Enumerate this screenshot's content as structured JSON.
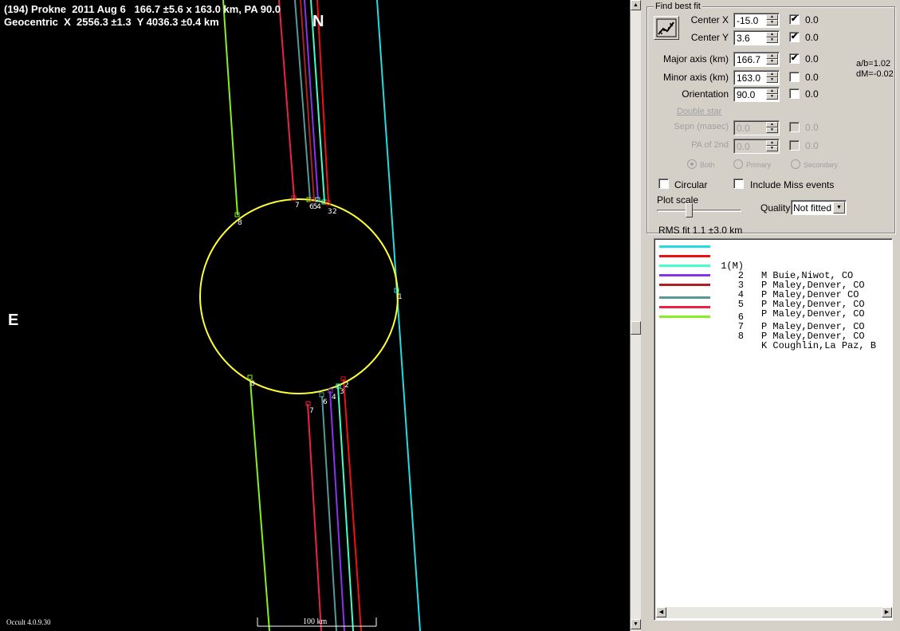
{
  "plot": {
    "title_line1": "(194) Prokne  2011 Aug 6   166.7 ±5.6 x 163.0 km, PA 90.0",
    "title_line2": "Geocentric  X  2556.3 ±1.3  Y 4036.3 ±0.4 km",
    "north_label": "N",
    "east_label": "E",
    "version": "Occult 4.0.9.30",
    "scale_label": "100 km",
    "colors": {
      "background": "#000000",
      "ellipse": "#ffff33"
    },
    "chords": [
      {
        "id": "1",
        "color": "#22dddd",
        "markers": []
      },
      {
        "id": "2",
        "color": "#ee1111",
        "markers": [
          "2",
          "2"
        ]
      },
      {
        "id": "3",
        "color": "#44ffcc",
        "markers": [
          "3",
          "3"
        ]
      },
      {
        "id": "4",
        "color": "#8833ee",
        "markers": [
          "4",
          "4"
        ]
      },
      {
        "id": "5",
        "color": "#bb2222",
        "markers": [
          "5"
        ]
      },
      {
        "id": "6",
        "color": "#559999",
        "markers": [
          "6",
          "6"
        ]
      },
      {
        "id": "7",
        "color": "#ee2244",
        "markers": [
          "7",
          "7"
        ]
      },
      {
        "id": "8",
        "color": "#88ee22",
        "markers": [
          "8",
          "8"
        ]
      }
    ],
    "top_marker_text": "6 5 4"
  },
  "panel": {
    "group_title": "Find best fit",
    "fields": {
      "center_x": {
        "label": "Center X",
        "value": "-15.0",
        "checked": true,
        "fit": "0.0"
      },
      "center_y": {
        "label": "Center Y",
        "value": "3.6",
        "checked": true,
        "fit": "0.0"
      },
      "major_axis": {
        "label": "Major axis (km)",
        "value": "166.7",
        "checked": true,
        "fit": "0.0"
      },
      "minor_axis": {
        "label": "Minor axis (km)",
        "value": "163.0",
        "checked": false,
        "fit": "0.0"
      },
      "orientation": {
        "label": "Orientation",
        "value": "90.0",
        "checked": false,
        "fit": "0.0"
      },
      "double_star": "Double star",
      "sepn": {
        "label": "Sepn (masec)",
        "value": "0.0",
        "checked": false,
        "fit": "0.0"
      },
      "pa_2nd": {
        "label": "PA of 2nd",
        "value": "0.0",
        "checked": false,
        "fit": "0.0"
      }
    },
    "ratio_ab": "a/b=1.02",
    "ratio_dm": "dM=-0.02",
    "radio_both": "Both",
    "radio_primary": "Primary",
    "radio_secondary": "Secondary",
    "circular_label": "Circular",
    "include_miss_label": "Include Miss events",
    "plot_scale_label": "Plot scale",
    "plot_scale_value": 0.4,
    "quality_label": "Quality",
    "quality_value": "Not fitted",
    "rms_fit": "RMS fit 1.1 ±3.0 km",
    "observers": [
      {
        "num": "1(M)",
        "text": "M Buie,Niwot, CO",
        "color": "#22dddd"
      },
      {
        "num": "2",
        "text": "P Maley,Denver, CO",
        "color": "#ee1111"
      },
      {
        "num": "3",
        "text": "P Maley,Denver CO",
        "color": "#44ffcc"
      },
      {
        "num": "4",
        "text": "P Maley,Denver, CO",
        "color": "#8833ee"
      },
      {
        "num": "5",
        "text": "P Maley,Denver, CO",
        "color": "#aa2222"
      },
      {
        "num": "6",
        "text": "P Maley,Denver, CO",
        "color": "#559999"
      },
      {
        "num": "7",
        "text": "P Maley,Denver, CO",
        "color": "#ee2244"
      },
      {
        "num": "8",
        "text": "K Coughlin,La Paz, B",
        "color": "#88ee22"
      }
    ]
  }
}
